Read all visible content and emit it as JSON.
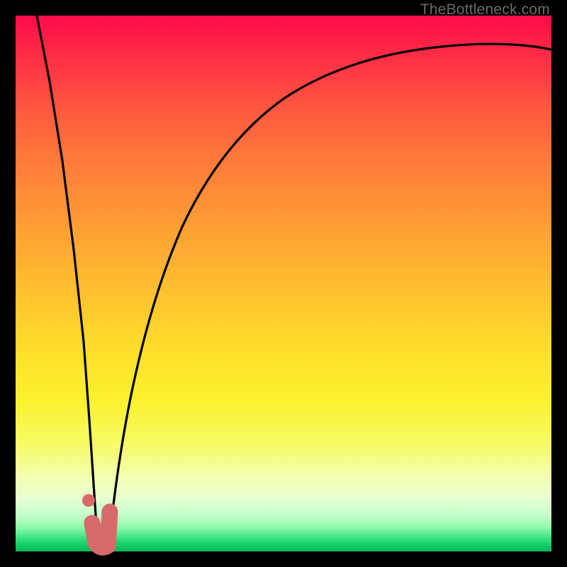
{
  "watermark": "TheBottleneck.com",
  "colors": {
    "frame": "#000000",
    "gradient_top": "#ff0b49",
    "gradient_mid": "#ffe02b",
    "gradient_bottom": "#06b956",
    "curve": "#000000",
    "marker": "#d96a6a"
  },
  "chart_data": {
    "type": "line",
    "title": "",
    "xlabel": "",
    "ylabel": "",
    "xlim": [
      0,
      100
    ],
    "ylim": [
      0,
      100
    ],
    "grid": false,
    "legend": false,
    "series": [
      {
        "name": "left-branch",
        "x": [
          4,
          6,
          8,
          10,
          12,
          13.5,
          14.5
        ],
        "y": [
          100,
          84,
          67,
          49,
          29,
          12,
          2
        ]
      },
      {
        "name": "right-branch",
        "x": [
          17,
          19,
          22,
          26,
          31,
          38,
          46,
          56,
          68,
          82,
          100
        ],
        "y": [
          2,
          14,
          29,
          45,
          58,
          69,
          77,
          83,
          88,
          91,
          93
        ]
      }
    ],
    "markers": [
      {
        "name": "pink-dot",
        "x": 13.3,
        "y": 9.5
      },
      {
        "name": "pink-hook-top",
        "x": 14.0,
        "y": 5.0
      },
      {
        "name": "pink-hook-bottom",
        "x": 15.5,
        "y": 1.0
      },
      {
        "name": "pink-hook-right",
        "x": 17.3,
        "y": 6.8
      }
    ],
    "notes": "y=0 at bottom (green), y=100 at top (red). x=0 at left. No axis ticks or labels are visible; values are proportional estimates from pixel positions inside the 756×756 plot area."
  }
}
